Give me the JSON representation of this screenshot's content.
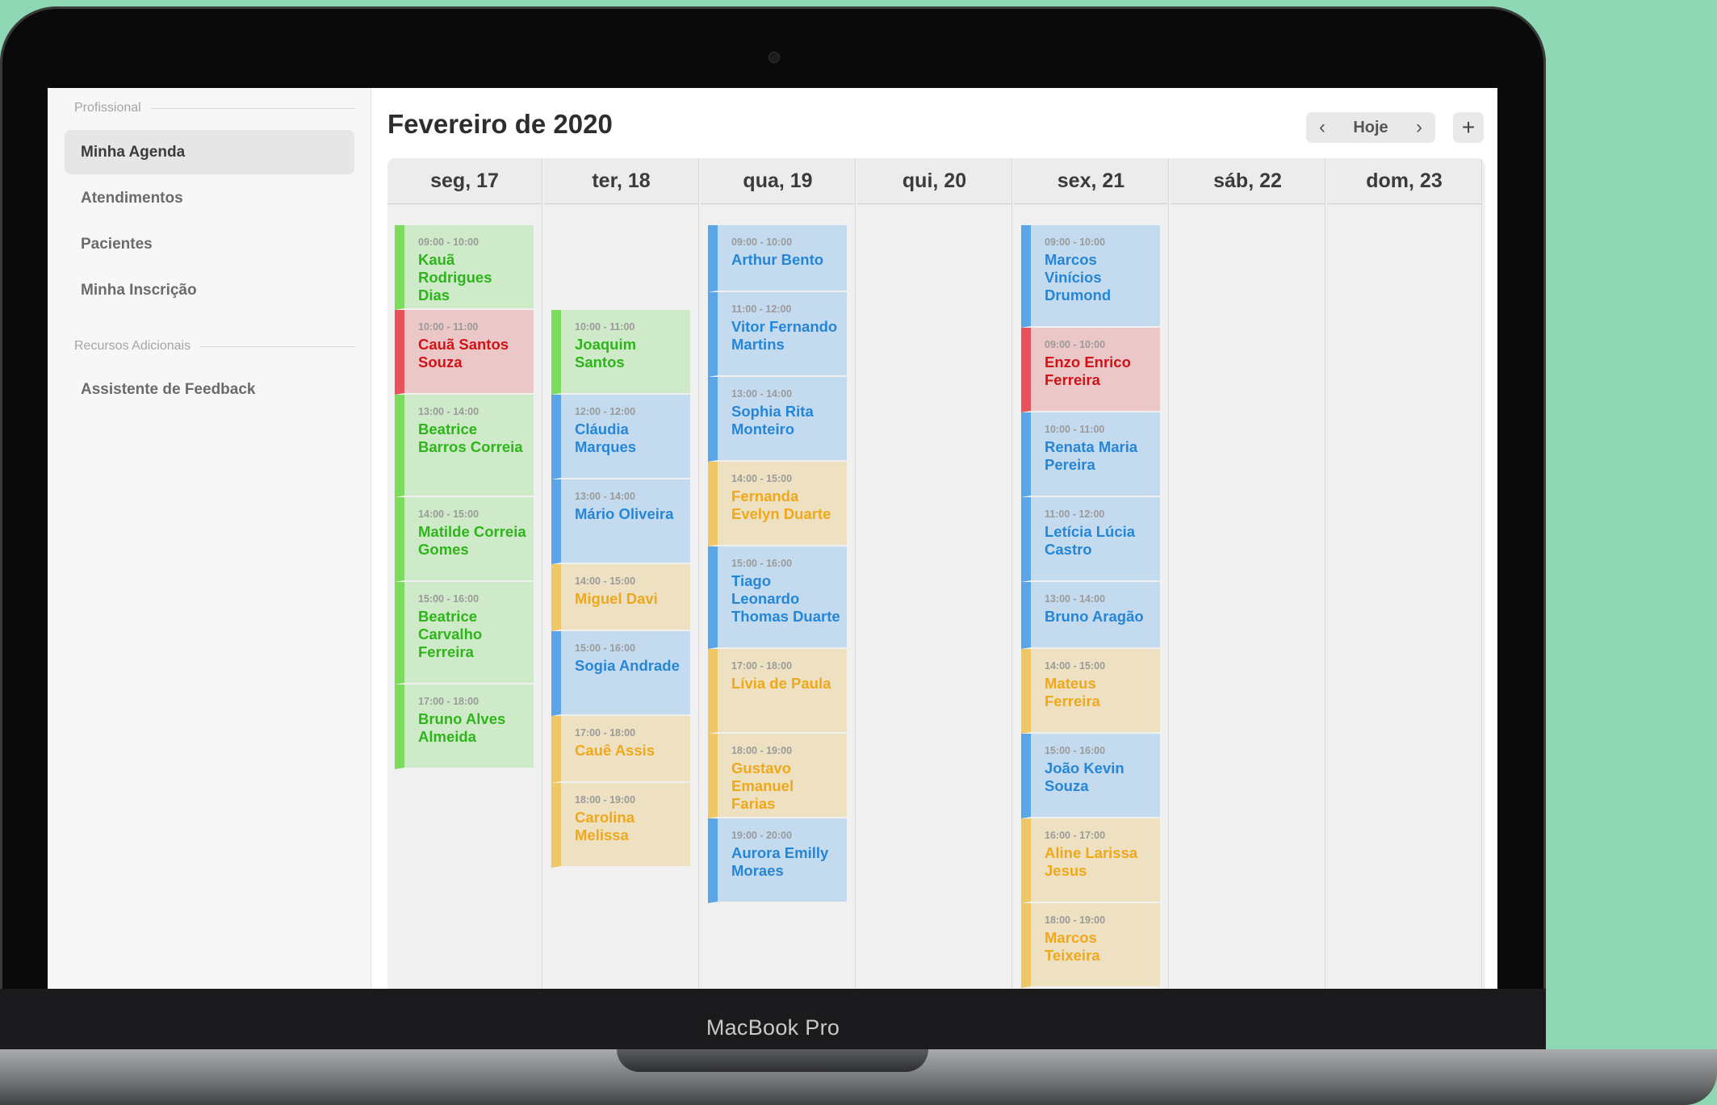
{
  "device_label": "MacBook Pro",
  "sidebar": {
    "section1": "Profissional",
    "items": [
      {
        "label": "Minha Agenda",
        "active": true
      },
      {
        "label": "Atendimentos",
        "active": false
      },
      {
        "label": "Pacientes",
        "active": false
      },
      {
        "label": "Minha Inscrição",
        "active": false
      }
    ],
    "section2": "Recursos Adicionais",
    "extra_items": [
      {
        "label": "Assistente de Feedback"
      }
    ]
  },
  "header": {
    "title": "Fevereiro de 2020",
    "prev_icon": "chevron-left-icon",
    "today_label": "Hoje",
    "next_icon": "chevron-right-icon",
    "add_label": "+"
  },
  "colors": {
    "green": "#2db51a",
    "red": "#d11217",
    "blue": "#2586d8",
    "yellow": "#efa81b",
    "background": "#8ed8b5"
  },
  "days": [
    {
      "label": "seg, 17",
      "events": [
        {
          "time": "09:00 - 10:00",
          "name": "Kauã Rodrigues Dias",
          "color": "green"
        },
        {
          "time": "10:00 - 11:00",
          "name": "Cauã Santos Souza",
          "color": "red"
        },
        {
          "time": "13:00 - 14:00",
          "name": "Beatrice Barros Correia",
          "color": "green"
        },
        {
          "time": "14:00 - 15:00",
          "name": "Matilde Correia Gomes",
          "color": "green"
        },
        {
          "time": "15:00 - 16:00",
          "name": "Beatrice Carvalho Ferreira",
          "color": "green"
        },
        {
          "time": "17:00 - 18:00",
          "name": "Bruno Alves Almeida",
          "color": "green"
        }
      ]
    },
    {
      "label": "ter, 18",
      "events": [
        {
          "time": "10:00 - 11:00",
          "name": "Joaquim Santos",
          "color": "green"
        },
        {
          "time": "12:00 - 12:00",
          "name": "Cláudia Marques",
          "color": "blue"
        },
        {
          "time": "13:00 - 14:00",
          "name": "Mário Oliveira",
          "color": "blue"
        },
        {
          "time": "14:00 - 15:00",
          "name": "Miguel Davi",
          "color": "yellow"
        },
        {
          "time": "15:00 - 16:00",
          "name": "Sogia Andrade",
          "color": "blue"
        },
        {
          "time": "17:00 - 18:00",
          "name": "Cauê Assis",
          "color": "yellow"
        },
        {
          "time": "18:00 - 19:00",
          "name": "Carolina Melissa",
          "color": "yellow"
        }
      ]
    },
    {
      "label": "qua, 19",
      "events": [
        {
          "time": "09:00 - 10:00",
          "name": "Arthur Bento",
          "color": "blue"
        },
        {
          "time": "11:00 - 12:00",
          "name": "Vitor Fernando Martins",
          "color": "blue"
        },
        {
          "time": "13:00 - 14:00",
          "name": "Sophia Rita Monteiro",
          "color": "blue"
        },
        {
          "time": "14:00 - 15:00",
          "name": "Fernanda Evelyn Duarte",
          "color": "yellow"
        },
        {
          "time": "15:00 - 16:00",
          "name": "Tiago Leonardo Thomas Duarte",
          "color": "blue"
        },
        {
          "time": "17:00 - 18:00",
          "name": "Lívia de Paula",
          "color": "yellow"
        },
        {
          "time": "18:00 - 19:00",
          "name": "Gustavo Emanuel Farias",
          "color": "yellow"
        },
        {
          "time": "19:00 - 20:00",
          "name": "Aurora Emilly Moraes",
          "color": "blue"
        }
      ]
    },
    {
      "label": "qui, 20",
      "events": []
    },
    {
      "label": "sex, 21",
      "events": [
        {
          "time": "09:00 - 10:00",
          "name": "Marcos Vinícios Drumond",
          "color": "blue"
        },
        {
          "time": "09:00 - 10:00",
          "name": "Enzo Enrico Ferreira",
          "color": "red"
        },
        {
          "time": "10:00 - 11:00",
          "name": "Renata Maria Pereira",
          "color": "blue"
        },
        {
          "time": "11:00 - 12:00",
          "name": "Letícia Lúcia Castro",
          "color": "blue"
        },
        {
          "time": "13:00 - 14:00",
          "name": "Bruno Aragão",
          "color": "blue"
        },
        {
          "time": "14:00 - 15:00",
          "name": "Mateus Ferreira",
          "color": "yellow"
        },
        {
          "time": "15:00 - 16:00",
          "name": "João Kevin Souza",
          "color": "blue"
        },
        {
          "time": "16:00 - 17:00",
          "name": "Aline Larissa Jesus",
          "color": "yellow"
        },
        {
          "time": "18:00 - 19:00",
          "name": "Marcos Teixeira",
          "color": "yellow"
        }
      ]
    },
    {
      "label": "sáb, 22",
      "events": []
    },
    {
      "label": "dom, 23",
      "events": []
    }
  ]
}
